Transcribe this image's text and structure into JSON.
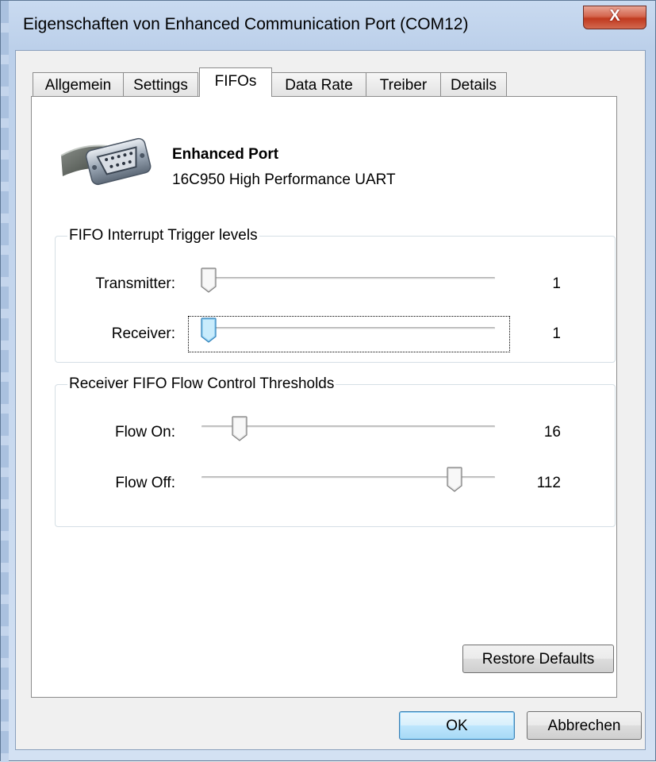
{
  "window": {
    "title": "Eigenschaften von Enhanced Communication Port (COM12)",
    "close_label": "X"
  },
  "tabs": [
    {
      "label": "Allgemein",
      "active": false
    },
    {
      "label": "Settings",
      "active": false
    },
    {
      "label": "FIFOs",
      "active": true
    },
    {
      "label": "Data Rate",
      "active": false
    },
    {
      "label": "Treiber",
      "active": false
    },
    {
      "label": "Details",
      "active": false
    }
  ],
  "device": {
    "icon": "serial-port-icon",
    "name": "Enhanced Port",
    "description": "16C950 High Performance UART"
  },
  "interrupt_group": {
    "title": "FIFO Interrupt Trigger levels",
    "transmitter": {
      "label": "Transmitter:",
      "value": "1",
      "position": 0.0
    },
    "receiver": {
      "label": "Receiver:",
      "value": "1",
      "position": 0.0,
      "focused": true
    }
  },
  "flow_group": {
    "title": "Receiver FIFO Flow Control Thresholds",
    "flow_on": {
      "label": "Flow On:",
      "value": "16",
      "position": 0.14
    },
    "flow_off": {
      "label": "Flow Off:",
      "value": "112",
      "position": 0.86
    }
  },
  "buttons": {
    "restore_defaults": "Restore Defaults",
    "ok": "OK",
    "cancel": "Abbrechen"
  },
  "colors": {
    "title_bar": "#bcd0ea",
    "close_button": "#c0391f",
    "focus_thumb": "#5ab4e8",
    "default_button": "#bee6fd"
  }
}
